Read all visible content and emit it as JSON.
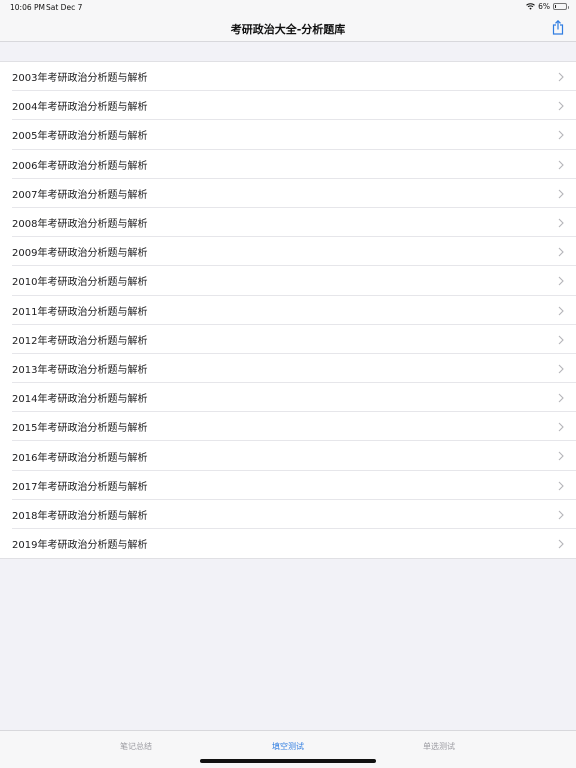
{
  "status_bar": {
    "time": "10:06 PM",
    "date": "Sat Dec 7",
    "battery_text": "6%",
    "battery_level": 0.06
  },
  "nav_bar": {
    "title": "考研政治大全-分析题库",
    "share_icon": "share-icon"
  },
  "list": {
    "items": [
      {
        "label": "2003年考研政治分析题与解析"
      },
      {
        "label": "2004年考研政治分析题与解析"
      },
      {
        "label": "2005年考研政治分析题与解析"
      },
      {
        "label": "2006年考研政治分析题与解析"
      },
      {
        "label": "2007年考研政治分析题与解析"
      },
      {
        "label": "2008年考研政治分析题与解析"
      },
      {
        "label": "2009年考研政治分析题与解析"
      },
      {
        "label": "2010年考研政治分析题与解析"
      },
      {
        "label": "2011年考研政治分析题与解析"
      },
      {
        "label": "2012年考研政治分析题与解析"
      },
      {
        "label": "2013年考研政治分析题与解析"
      },
      {
        "label": "2014年考研政治分析题与解析"
      },
      {
        "label": "2015年考研政治分析题与解析"
      },
      {
        "label": "2016年考研政治分析题与解析"
      },
      {
        "label": "2017年考研政治分析题与解析"
      },
      {
        "label": "2018年考研政治分析题与解析"
      },
      {
        "label": "2019年考研政治分析题与解析"
      }
    ]
  },
  "tab_bar": {
    "tabs": [
      {
        "label": "笔记总结",
        "active": false
      },
      {
        "label": "填空测试",
        "active": true
      },
      {
        "label": "单选测试",
        "active": false
      }
    ],
    "accent_color": "#2f7de1"
  }
}
